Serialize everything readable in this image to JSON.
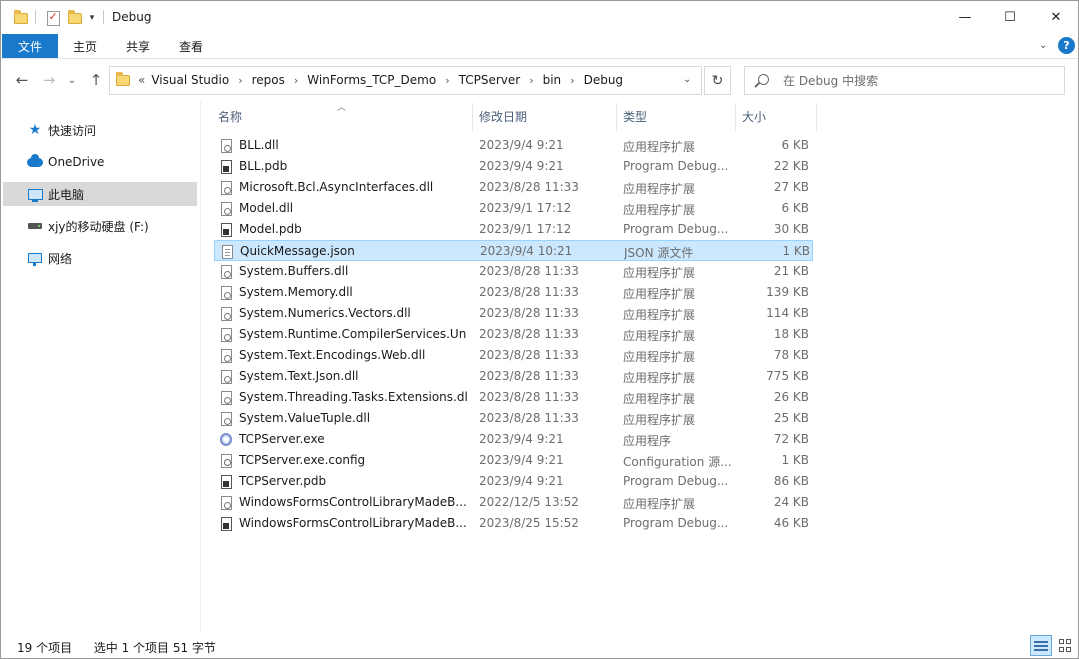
{
  "window": {
    "title": "Debug",
    "minimize_glyph": "—",
    "maximize_glyph": "☐",
    "close_glyph": "✕"
  },
  "ribbon": {
    "tabs": [
      "文件",
      "主页",
      "共享",
      "查看"
    ],
    "help_glyph": "?"
  },
  "address": {
    "prefix": "«",
    "breadcrumb": [
      "Visual Studio",
      "repos",
      "WinForms_TCP_Demo",
      "TCPServer",
      "bin",
      "Debug"
    ]
  },
  "search": {
    "placeholder": "在 Debug 中搜索"
  },
  "nav": {
    "items": [
      {
        "label": "快速访问",
        "icon": "star-icon"
      },
      {
        "label": "OneDrive",
        "icon": "cloud-icon"
      },
      {
        "label": "此电脑",
        "icon": "computer-icon",
        "selected": true
      },
      {
        "label": "xjy的移动硬盘 (F:)",
        "icon": "drive-icon"
      },
      {
        "label": "网络",
        "icon": "network-icon"
      }
    ]
  },
  "columns": {
    "name": "名称",
    "date": "修改日期",
    "type": "类型",
    "size": "大小"
  },
  "files": [
    {
      "name": "BLL.dll",
      "date": "2023/9/4 9:21",
      "type": "应用程序扩展",
      "size": "6 KB",
      "icon": "dll"
    },
    {
      "name": "BLL.pdb",
      "date": "2023/9/4 9:21",
      "type": "Program Debug...",
      "size": "22 KB",
      "icon": "pdb"
    },
    {
      "name": "Microsoft.Bcl.AsyncInterfaces.dll",
      "date": "2023/8/28 11:33",
      "type": "应用程序扩展",
      "size": "27 KB",
      "icon": "dll"
    },
    {
      "name": "Model.dll",
      "date": "2023/9/1 17:12",
      "type": "应用程序扩展",
      "size": "6 KB",
      "icon": "dll"
    },
    {
      "name": "Model.pdb",
      "date": "2023/9/1 17:12",
      "type": "Program Debug...",
      "size": "30 KB",
      "icon": "pdb"
    },
    {
      "name": "QuickMessage.json",
      "date": "2023/9/4 10:21",
      "type": "JSON 源文件",
      "size": "1 KB",
      "icon": "json",
      "selected": true
    },
    {
      "name": "System.Buffers.dll",
      "date": "2023/8/28 11:33",
      "type": "应用程序扩展",
      "size": "21 KB",
      "icon": "dll"
    },
    {
      "name": "System.Memory.dll",
      "date": "2023/8/28 11:33",
      "type": "应用程序扩展",
      "size": "139 KB",
      "icon": "dll"
    },
    {
      "name": "System.Numerics.Vectors.dll",
      "date": "2023/8/28 11:33",
      "type": "应用程序扩展",
      "size": "114 KB",
      "icon": "dll"
    },
    {
      "name": "System.Runtime.CompilerServices.Un...",
      "date": "2023/8/28 11:33",
      "type": "应用程序扩展",
      "size": "18 KB",
      "icon": "dll"
    },
    {
      "name": "System.Text.Encodings.Web.dll",
      "date": "2023/8/28 11:33",
      "type": "应用程序扩展",
      "size": "78 KB",
      "icon": "dll"
    },
    {
      "name": "System.Text.Json.dll",
      "date": "2023/8/28 11:33",
      "type": "应用程序扩展",
      "size": "775 KB",
      "icon": "dll"
    },
    {
      "name": "System.Threading.Tasks.Extensions.dll",
      "date": "2023/8/28 11:33",
      "type": "应用程序扩展",
      "size": "26 KB",
      "icon": "dll"
    },
    {
      "name": "System.ValueTuple.dll",
      "date": "2023/8/28 11:33",
      "type": "应用程序扩展",
      "size": "25 KB",
      "icon": "dll"
    },
    {
      "name": "TCPServer.exe",
      "date": "2023/9/4 9:21",
      "type": "应用程序",
      "size": "72 KB",
      "icon": "exe"
    },
    {
      "name": "TCPServer.exe.config",
      "date": "2023/9/4 9:21",
      "type": "Configuration 源...",
      "size": "1 KB",
      "icon": "config"
    },
    {
      "name": "TCPServer.pdb",
      "date": "2023/9/4 9:21",
      "type": "Program Debug...",
      "size": "86 KB",
      "icon": "pdb"
    },
    {
      "name": "WindowsFormsControlLibraryMadeB...",
      "date": "2022/12/5 13:52",
      "type": "应用程序扩展",
      "size": "24 KB",
      "icon": "dll"
    },
    {
      "name": "WindowsFormsControlLibraryMadeB...",
      "date": "2023/8/25 15:52",
      "type": "Program Debug...",
      "size": "46 KB",
      "icon": "pdb"
    }
  ],
  "status": {
    "item_count": "19 个项目",
    "selection": "选中 1 个项目  51 字节"
  },
  "colors": {
    "accent": "#1979ca",
    "selection_bg": "#cce8ff",
    "selection_border": "#99d1ff"
  }
}
